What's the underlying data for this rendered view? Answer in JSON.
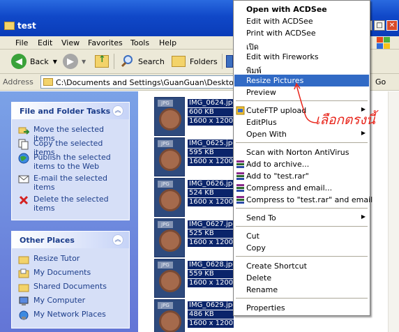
{
  "window": {
    "title": "test"
  },
  "menubar": [
    "File",
    "Edit",
    "View",
    "Favorites",
    "Tools",
    "Help"
  ],
  "toolbar": {
    "back": "Back",
    "search": "Search",
    "folders": "Folders"
  },
  "address": {
    "label": "Address",
    "path": "C:\\Documents and Settings\\GuanGuan\\Desktop\\Resi",
    "go": "Go"
  },
  "file_tasks": {
    "title": "File and Folder Tasks",
    "items": [
      {
        "label": "Move the selected items"
      },
      {
        "label": "Copy the selected items"
      },
      {
        "label": "Publish the selected items to the Web"
      },
      {
        "label": "E-mail the selected items"
      },
      {
        "label": "Delete the selected items"
      }
    ]
  },
  "other_places": {
    "title": "Other Places",
    "items": [
      {
        "label": "Resize Tutor"
      },
      {
        "label": "My Documents"
      },
      {
        "label": "Shared Documents"
      },
      {
        "label": "My Computer"
      },
      {
        "label": "My Network Places"
      }
    ]
  },
  "files": [
    {
      "name": "IMG_0624.jpg",
      "size": "600 KB",
      "dims": "1600 x 1200"
    },
    {
      "name": "IMG_0625.jpg",
      "size": "595 KB",
      "dims": "1600 x 1200"
    },
    {
      "name": "IMG_0626.jpg",
      "size": "524 KB",
      "dims": "1600 x 1200"
    },
    {
      "name": "IMG_0627.jpg",
      "size": "525 KB",
      "dims": "1600 x 1200"
    },
    {
      "name": "IMG_0628.jpg",
      "size": "559 KB",
      "dims": "1600 x 1200"
    },
    {
      "name": "IMG_0629.jpg",
      "size": "486 KB",
      "dims": "1600 x 1200"
    }
  ],
  "thumb_tag": "JPG",
  "context_menu": [
    {
      "label": "Open with ACDSee",
      "bold": true
    },
    {
      "label": "Edit with ACDSee"
    },
    {
      "label": "Print with ACDSee"
    },
    {
      "label": "เปิด"
    },
    {
      "label": "Edit with Fireworks"
    },
    {
      "label": "พิมพ์"
    },
    {
      "label": "Resize Pictures",
      "selected": true
    },
    {
      "label": "Preview"
    },
    {
      "label": "CuteFTP upload",
      "arrow": true
    },
    {
      "label": "EditPlus"
    },
    {
      "label": "Open With",
      "arrow": true
    },
    {
      "label": "Scan with Norton AntiVirus"
    },
    {
      "label": "Add to archive..."
    },
    {
      "label": "Add to \"test.rar\""
    },
    {
      "label": "Compress and email..."
    },
    {
      "label": "Compress to \"test.rar\" and email"
    },
    {
      "label": "Send To",
      "arrow": true
    },
    {
      "label": "Cut"
    },
    {
      "label": "Copy"
    },
    {
      "label": "Create Shortcut"
    },
    {
      "label": "Delete"
    },
    {
      "label": "Rename"
    },
    {
      "label": "Properties"
    }
  ],
  "annotation": "เลือกตรงนี้",
  "colors": {
    "selection": "#316ac5",
    "annotation": "#e8241a",
    "title_bar": "#1048c8"
  }
}
